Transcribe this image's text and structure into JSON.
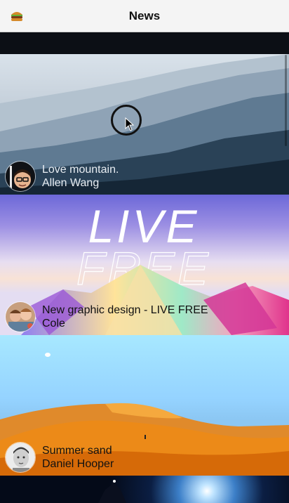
{
  "header": {
    "title": "News",
    "menu_icon": "burger-icon"
  },
  "feed": [
    {
      "title": "Love mountain.",
      "author": "Allen Wang",
      "image": "mountain-fog-photo"
    },
    {
      "title": "New graphic design - LIVE FREE",
      "author": "Cole",
      "image": "live-free-graphic"
    },
    {
      "title": "Summer sand",
      "author": "Daniel Hooper",
      "image": "desert-dunes-photo"
    },
    {
      "title": "",
      "author": "",
      "image": "night-sky-silhouette-photo"
    }
  ],
  "artwork_text": {
    "line1": "LIVE",
    "line2": "FREE"
  },
  "colors": {
    "navbar_bg": "#f4f4f4",
    "feed_bg": "#000000"
  }
}
